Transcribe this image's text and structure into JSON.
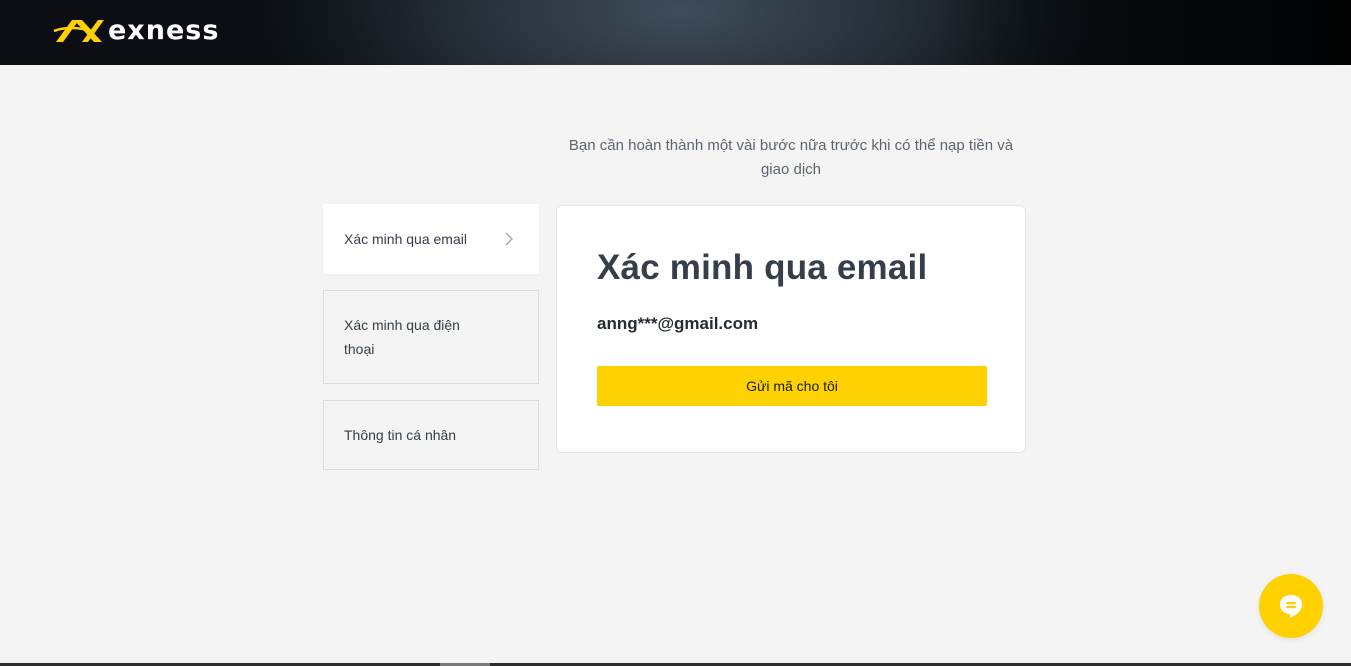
{
  "header": {
    "brand_name": "exness",
    "brand_color": "#ffd100",
    "logo_icon": "exness-logo-icon"
  },
  "intro": {
    "text": "Bạn cần hoàn thành một vài bước nữa trước khi có thể nạp tiền và giao dịch"
  },
  "steps": {
    "items": [
      {
        "label": "Xác minh qua email",
        "active": true
      },
      {
        "label": "Xác minh qua điện thoại",
        "active": false
      },
      {
        "label": "Thông tin cá nhân",
        "active": false
      }
    ]
  },
  "card": {
    "title": "Xác minh qua email",
    "email": "anng***@gmail.com",
    "send_button_label": "Gửi mã cho tôi"
  },
  "chat": {
    "icon": "chat-icon"
  },
  "colors": {
    "accent": "#ffd100",
    "text": "#353e49",
    "background": "#f4f4f4"
  }
}
